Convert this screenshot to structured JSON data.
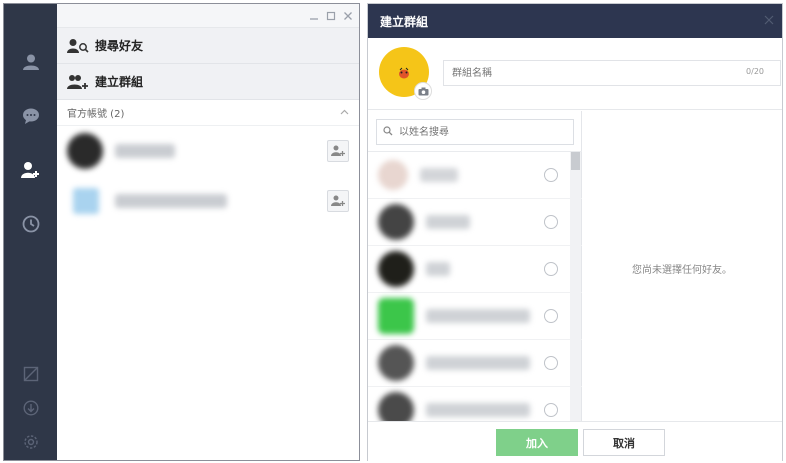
{
  "left_window": {
    "menu": {
      "search_friends_label": "搜尋好友",
      "create_group_label": "建立群組"
    },
    "section": {
      "official_accounts_label": "官方帳號 (2)"
    }
  },
  "right_window": {
    "title": "建立群組",
    "group_name": {
      "placeholder": "群組名稱",
      "counter": "0/20"
    },
    "search": {
      "placeholder": "以姓名搜尋"
    },
    "empty_message": "您尚未選擇任何好友。",
    "buttons": {
      "join_label": "加入",
      "cancel_label": "取消"
    }
  },
  "colors": {
    "nav_bg": "#2f3748",
    "header_bg": "#2d3650",
    "join_button": "#7fd08a",
    "group_avatar": "#f5c518"
  }
}
